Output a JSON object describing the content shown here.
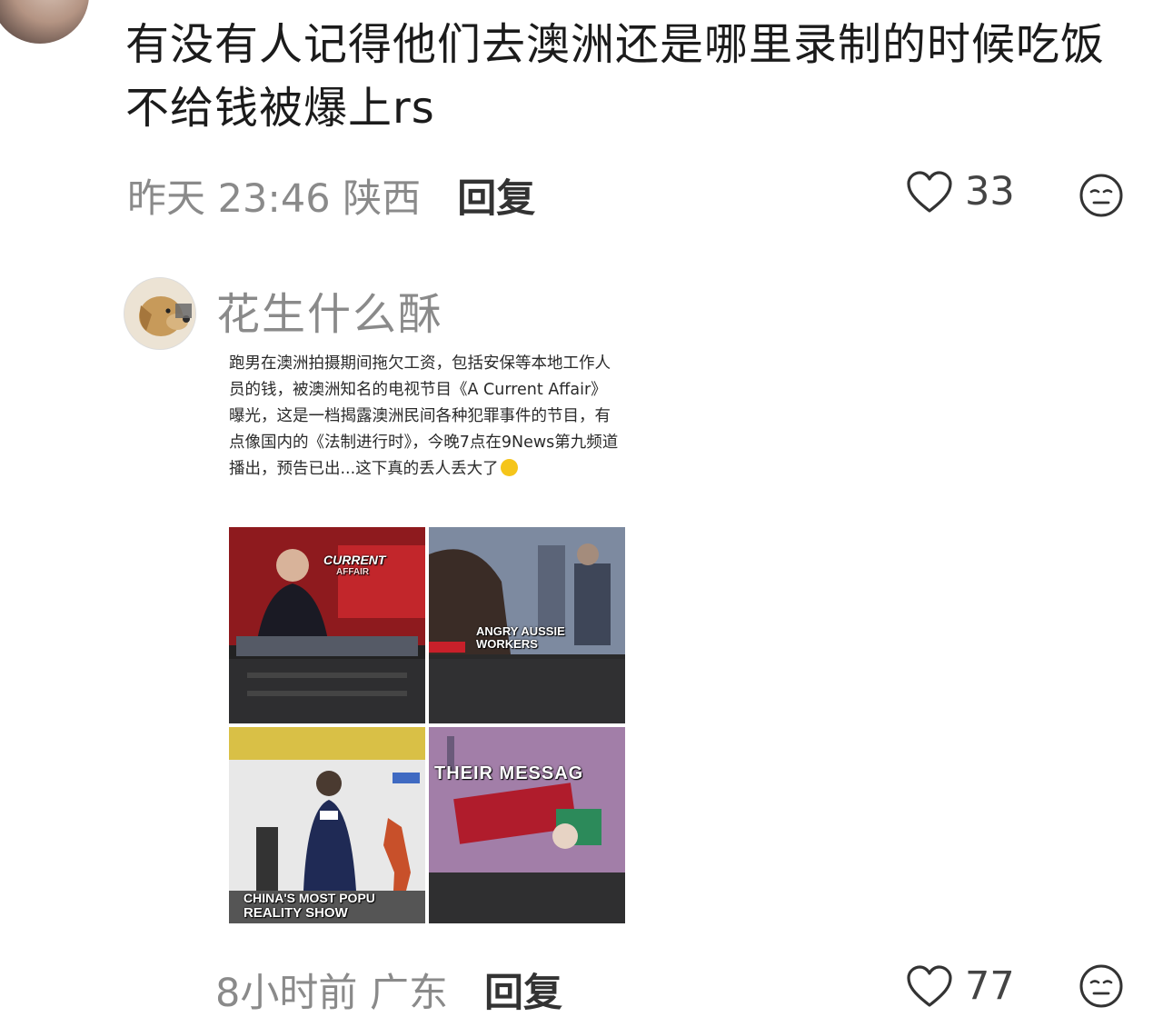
{
  "comment1": {
    "text": "有没有人记得他们去澳洲还是哪里录制的时候吃饭不给钱被爆上rs",
    "time_location": "昨天 23:46 陕西",
    "reply_label": "回复",
    "likes": "33",
    "like_icon": "heart-outline-icon",
    "emoji_icon": "neutral-face-icon"
  },
  "comment2": {
    "username": "花生什么酥",
    "time_location": "8小时前 广东",
    "reply_label": "回复",
    "likes": "77",
    "like_icon": "heart-outline-icon",
    "emoji_icon": "neutral-face-icon",
    "image": {
      "text": "跑男在澳洲拍摄期间拖欠工资，包括安保等本地工作人员的钱，被澳洲知名的电视节目《A Current Affair》曝光，这是一档揭露澳洲民间各种犯罪事件的节目，有点像国内的《法制进行时》，今晚7点在9News第九频道播出，预告已出...这下真的丢人丢大了",
      "tiles": [
        {
          "caption_line1": "CURRENT",
          "caption_line2": "AFFAIR"
        },
        {
          "caption_line1": "ANGRY AUSSIE",
          "caption_line2": "WORKERS"
        },
        {
          "caption_line1": "CHINA'S MOST POPU",
          "caption_line2": "REALITY SHOW"
        },
        {
          "caption_line1": "THEIR MESSAG",
          "caption_line2": ""
        }
      ]
    }
  },
  "colors": {
    "meta_gray": "#8a8a8a",
    "reply_dark": "#333333",
    "accent_red": "#c8202a"
  }
}
